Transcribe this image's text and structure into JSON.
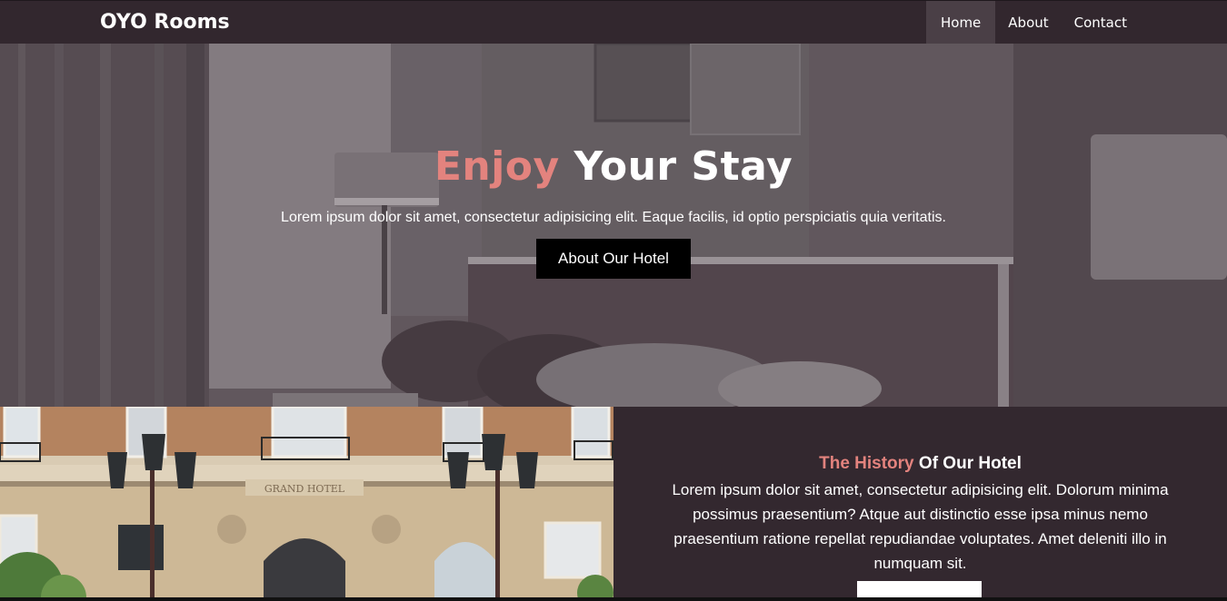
{
  "navbar": {
    "brand": "OYO Rooms",
    "links": [
      {
        "label": "Home",
        "active": true
      },
      {
        "label": "About",
        "active": false
      },
      {
        "label": "Contact",
        "active": false
      }
    ]
  },
  "hero": {
    "title_accent": "Enjoy",
    "title_rest": "Your Stay",
    "subtitle": "Lorem ipsum dolor sit amet, consectetur adipisicing elit. Eaque facilis, id optio perspiciatis quia veritatis.",
    "button_label": "About Our Hotel"
  },
  "history": {
    "title_accent": "The History",
    "title_rest": "Of Our Hotel",
    "body": "Lorem ipsum dolor sit amet, consectetur adipisicing elit. Dolorum minima possimus praesentium? Atque aut distinctio esse ipsa minus nemo praesentium ratione repellat repudiandae voluptates. Amet deleniti illo in numquam sit.",
    "photo_sign": "GRAND HOTEL"
  },
  "colors": {
    "accent": "#e3837e",
    "navbar": "#32272e",
    "section_bg": "#33282f",
    "hero_button": "#000000"
  }
}
